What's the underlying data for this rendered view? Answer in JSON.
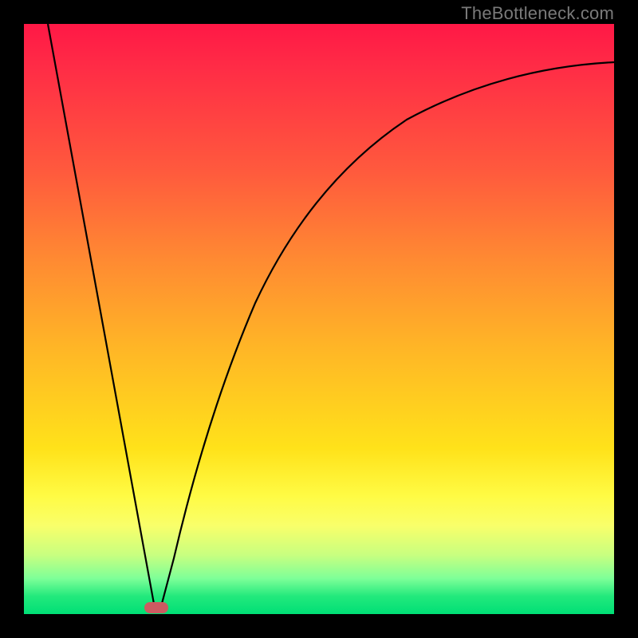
{
  "watermark": "TheBottleneck.com",
  "colors": {
    "frame": "#000000",
    "curve": "#000000",
    "marker": "#cc5b61",
    "gradient_top": "#ff1846",
    "gradient_bottom": "#00df76"
  },
  "chart_data": {
    "type": "line",
    "title": "",
    "xlabel": "",
    "ylabel": "",
    "xlim": [
      0,
      100
    ],
    "ylim": [
      0,
      100
    ],
    "annotations": [
      {
        "name": "optimal-marker",
        "x": 22,
        "y": 0
      }
    ],
    "series": [
      {
        "name": "left-branch",
        "x": [
          4,
          6,
          8,
          10,
          12,
          14,
          16,
          18,
          20,
          21,
          22
        ],
        "values": [
          100,
          89,
          78,
          67,
          56,
          44,
          33,
          22,
          11,
          5,
          0
        ]
      },
      {
        "name": "right-branch",
        "x": [
          22,
          24,
          26,
          28,
          30,
          33,
          36,
          40,
          45,
          50,
          55,
          60,
          66,
          72,
          80,
          88,
          100
        ],
        "values": [
          0,
          9,
          18,
          26,
          33,
          42,
          50,
          58,
          66,
          72,
          76,
          80,
          83,
          86,
          89,
          91,
          93
        ]
      }
    ]
  }
}
